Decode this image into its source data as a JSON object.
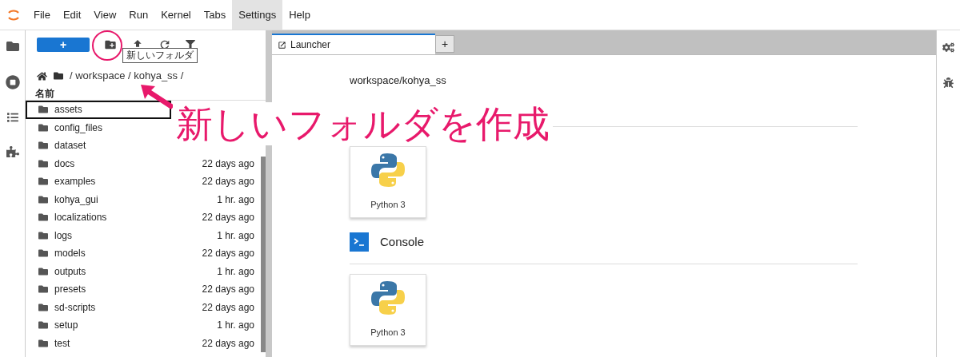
{
  "menu": [
    {
      "label": "File",
      "selected": false
    },
    {
      "label": "Edit",
      "selected": false
    },
    {
      "label": "View",
      "selected": false
    },
    {
      "label": "Run",
      "selected": false
    },
    {
      "label": "Kernel",
      "selected": false
    },
    {
      "label": "Tabs",
      "selected": false
    },
    {
      "label": "Settings",
      "selected": true
    },
    {
      "label": "Help",
      "selected": false
    }
  ],
  "toolbar": {
    "new_label": "+",
    "tooltip": "新しいフォルダ"
  },
  "breadcrumb": "/ workspace / kohya_ss /",
  "column_name": "名前",
  "files": [
    {
      "name": "assets",
      "selected": true
    },
    {
      "name": "config_files",
      "selected": false
    },
    {
      "name": "dataset",
      "selected": false
    },
    {
      "name": "docs",
      "modified": "22 days ago",
      "selected": false
    },
    {
      "name": "examples",
      "modified": "22 days ago",
      "selected": false
    },
    {
      "name": "kohya_gui",
      "modified": "1 hr. ago",
      "selected": false
    },
    {
      "name": "localizations",
      "modified": "22 days ago",
      "selected": false
    },
    {
      "name": "logs",
      "modified": "1 hr. ago",
      "selected": false
    },
    {
      "name": "models",
      "modified": "22 days ago",
      "selected": false
    },
    {
      "name": "outputs",
      "modified": "1 hr. ago",
      "selected": false
    },
    {
      "name": "presets",
      "modified": "22 days ago",
      "selected": false
    },
    {
      "name": "sd-scripts",
      "modified": "22 days ago",
      "selected": false
    },
    {
      "name": "setup",
      "modified": "1 hr. ago",
      "selected": false
    },
    {
      "name": "test",
      "modified": "22 days ago",
      "selected": false
    }
  ],
  "tabs": [
    {
      "label": "Launcher",
      "selected": true
    }
  ],
  "add_tab": "+",
  "launcher": {
    "path": "workspace/kohya_ss",
    "sections": [
      {
        "kind": "notebook",
        "cards": [
          {
            "label": "Python 3"
          }
        ]
      },
      {
        "kind": "console",
        "title": "Console",
        "cards": [
          {
            "label": "Python 3"
          }
        ]
      }
    ]
  },
  "annotation": {
    "text": "新しいフォルダを作成"
  }
}
